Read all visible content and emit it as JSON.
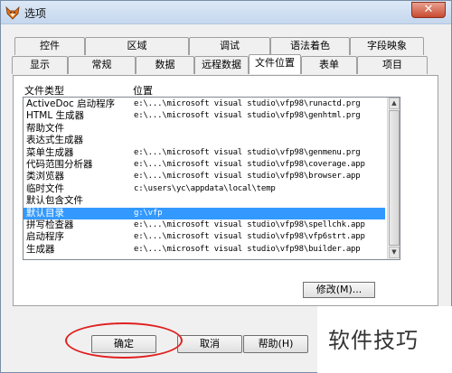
{
  "window": {
    "title": "选项",
    "close_label": "✕",
    "app_icon": "fox-icon"
  },
  "tabs_row1": [
    "控件",
    "区域",
    "调试",
    "语法着色",
    "字段映象"
  ],
  "tabs_row2": [
    "显示",
    "常规",
    "数据",
    "远程数据",
    "文件位置",
    "表单",
    "项目"
  ],
  "active_tab": "文件位置",
  "list": {
    "col_type": "文件类型",
    "col_path": "位置",
    "rows": [
      {
        "type": "ActiveDoc 启动程序",
        "path": "e:\\...\\microsoft visual studio\\vfp98\\runactd.prg"
      },
      {
        "type": "HTML 生成器",
        "path": "e:\\...\\microsoft visual studio\\vfp98\\genhtml.prg"
      },
      {
        "type": "帮助文件",
        "path": ""
      },
      {
        "type": "表达式生成器",
        "path": ""
      },
      {
        "type": "菜单生成器",
        "path": "e:\\...\\microsoft visual studio\\vfp98\\genmenu.prg"
      },
      {
        "type": "代码范围分析器",
        "path": "e:\\...\\microsoft visual studio\\vfp98\\coverage.app"
      },
      {
        "type": "类浏览器",
        "path": "e:\\...\\microsoft visual studio\\vfp98\\browser.app"
      },
      {
        "type": "临时文件",
        "path": "c:\\users\\yc\\appdata\\local\\temp"
      },
      {
        "type": "默认包含文件",
        "path": ""
      },
      {
        "type": "默认目录",
        "path": "g:\\vfp",
        "selected": true
      },
      {
        "type": "拼写检查器",
        "path": "e:\\...\\microsoft visual studio\\vfp98\\spellchk.app"
      },
      {
        "type": "启动程序",
        "path": "e:\\...\\microsoft visual studio\\vfp98\\vfp6strt.app"
      },
      {
        "type": "生成器",
        "path": "e:\\...\\microsoft visual studio\\vfp98\\builder.app"
      }
    ]
  },
  "buttons": {
    "modify": "修改(M)...",
    "ok": "确定",
    "cancel": "取消",
    "help": "帮助(H)"
  },
  "watermark": "软件技巧",
  "colors": {
    "selection": "#3399ff",
    "annotation_circle": "#e02020"
  }
}
